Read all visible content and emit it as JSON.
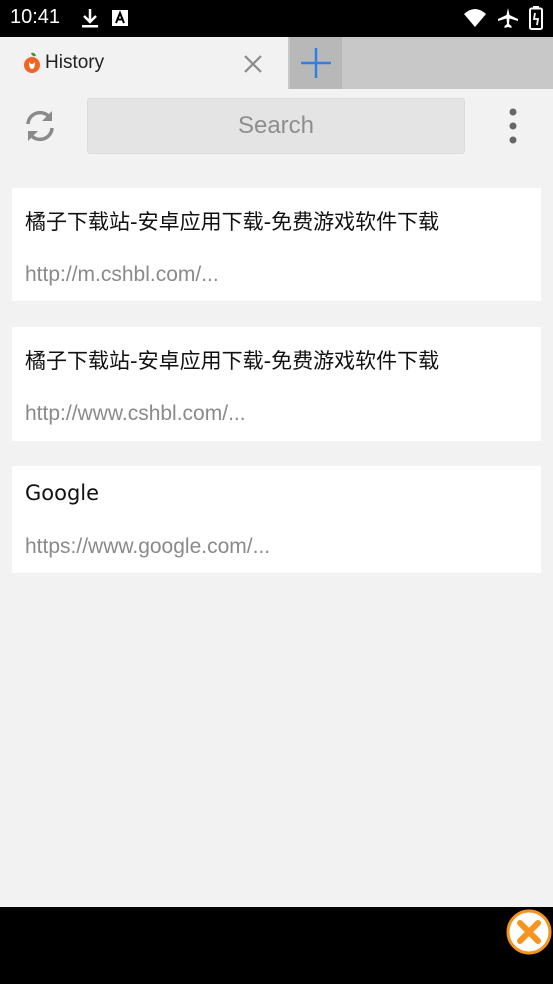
{
  "status_bar": {
    "time": "10:41",
    "icons_left": [
      "download-icon",
      "font-icon"
    ],
    "icons_right": [
      "wifi-icon",
      "airplane-icon",
      "battery-icon"
    ]
  },
  "tabs": [
    {
      "title": "History",
      "icon": "orange-logo-icon"
    }
  ],
  "toolbar": {
    "search_placeholder": "Search"
  },
  "history": [
    {
      "title": "橘子下载站-安卓应用下载-免费游戏软件下载",
      "url": "http://m.cshbl.com/..."
    },
    {
      "title": "橘子下载站-安卓应用下载-免费游戏软件下载",
      "url": "http://www.cshbl.com/..."
    },
    {
      "title": "Google",
      "url": "https://www.google.com/..."
    }
  ],
  "colors": {
    "accent": "#2f7fe0",
    "logo_orange": "#f26522",
    "ad_close_orange": "#f7941d"
  }
}
